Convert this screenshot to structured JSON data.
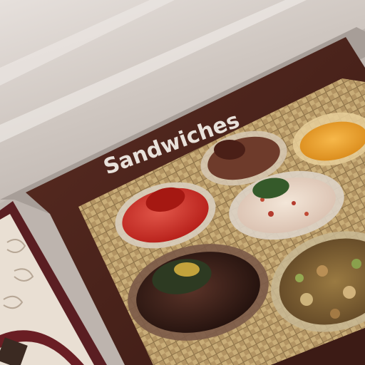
{
  "menu_page": {
    "section_title": "Sandwiches"
  },
  "colors": {
    "page_curl": "#d8d1cc",
    "menu_band": "#4a2219",
    "wicker": "#b79a66",
    "wicker_dark": "#7d6440",
    "ornate_panel": "#e9dfd3",
    "ornate_border": "#5a1e22"
  }
}
